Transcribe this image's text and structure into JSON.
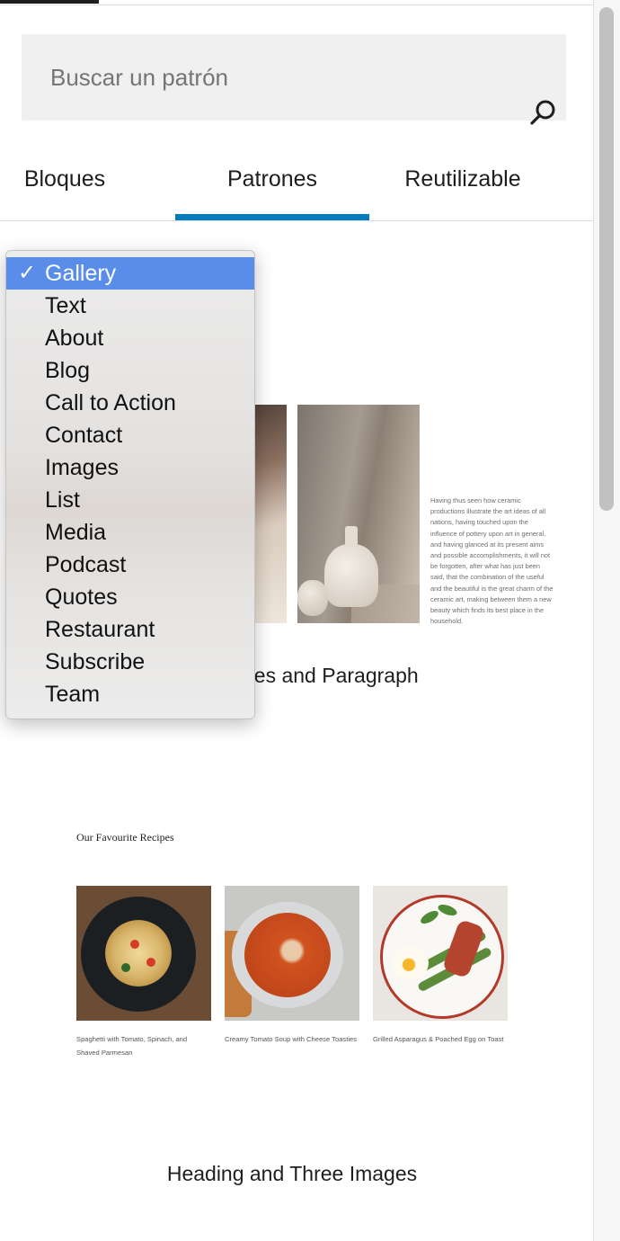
{
  "search": {
    "placeholder": "Buscar un patrón",
    "icon": "search-icon"
  },
  "tabs": [
    {
      "label": "Bloques",
      "active": false
    },
    {
      "label": "Patrones",
      "active": true
    },
    {
      "label": "Reutilizable",
      "active": false
    }
  ],
  "accent_color": "#007cba",
  "category_dropdown": {
    "selected": "Gallery",
    "check_mark": "✓",
    "options": [
      "Gallery",
      "Text",
      "About",
      "Blog",
      "Call to Action",
      "Contact",
      "Images",
      "List",
      "Media",
      "Podcast",
      "Quotes",
      "Restaurant",
      "Subscribe",
      "Team"
    ]
  },
  "pattern_1": {
    "paragraph": "Having thus seen how ceramic productions illustrate the art ideas of all nations, having touched upon the influence of pottery upon art in general, and having glanced at its present aims and possible accomplishments, it will not be forgotten, after what has just been said, that the combination of the useful and the beautiful is the great charm of the ceramic art, making between them a new beauty which finds its best place in the household.",
    "caption_visible": "ges and Paragraph"
  },
  "pattern_2": {
    "heading": "Our Favourite Recipes",
    "recipes": [
      {
        "caption": "Spaghetti with Tomato, Spinach, and Shaved Parmesan"
      },
      {
        "caption": "Creamy Tomato Soup with Cheese Toasties"
      },
      {
        "caption": "Grilled Asparagus & Poached Egg on Toast"
      }
    ],
    "caption": "Heading and Three Images"
  }
}
